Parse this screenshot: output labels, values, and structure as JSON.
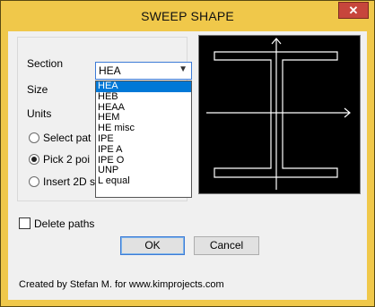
{
  "window": {
    "title": "SWEEP SHAPE",
    "close_glyph": "✕"
  },
  "form": {
    "section_label": "Section",
    "size_label": "Size",
    "units_label": "Units",
    "section_value": "HEA",
    "radios": [
      {
        "label": "Select pat",
        "checked": false
      },
      {
        "label": "Pick 2 poi",
        "checked": true
      },
      {
        "label": "Insert 2D s",
        "checked": false
      }
    ]
  },
  "dropdown": {
    "items": [
      "HEA",
      "HEB",
      "HEAA",
      "HEM",
      "HE misc",
      "IPE",
      "IPE A",
      "IPE O",
      "UNP",
      "L equal"
    ],
    "selected_index": 0
  },
  "delete_paths": {
    "label": "Delete paths",
    "checked": false
  },
  "buttons": {
    "ok": "OK",
    "cancel": "Cancel"
  },
  "footer": "Created by Stefan M. for www.kimprojects.com",
  "colors": {
    "accent": "#0078d7",
    "title_bar": "#f0c84a",
    "preview_bg": "#000000",
    "preview_lines": "#ffffff"
  }
}
